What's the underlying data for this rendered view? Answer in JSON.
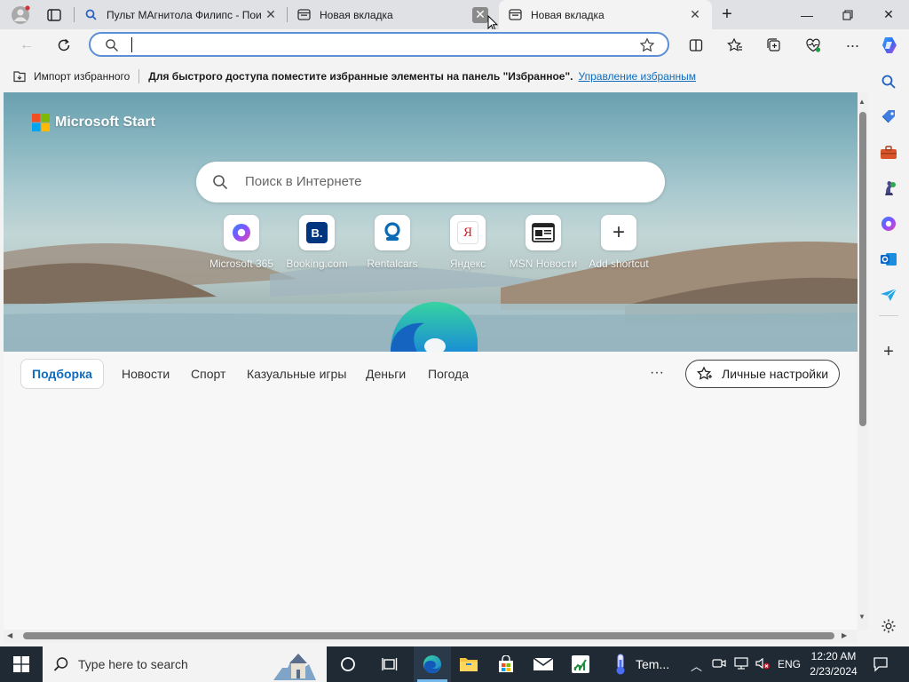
{
  "tabs": [
    {
      "title": "Пульт МАгнитола Филипс - Пои"
    },
    {
      "title": "Новая вкладка"
    },
    {
      "title": "Новая вкладка"
    }
  ],
  "favbar": {
    "import_label": "Импорт избранного",
    "hint": "Для быстрого доступа поместите избранные элементы на панель \"Избранное\".",
    "manage_link": "Управление избранным"
  },
  "page": {
    "brand": "Microsoft Start",
    "search_placeholder": "Поиск в Интернете",
    "quick_links": [
      {
        "label": "Microsoft 365",
        "icon": "microsoft365-icon"
      },
      {
        "label": "Booking.com",
        "icon": "booking-icon"
      },
      {
        "label": "Rentalcars",
        "icon": "rentalcars-icon"
      },
      {
        "label": "Яндекс",
        "icon": "yandex-icon"
      },
      {
        "label": "MSN Новости",
        "icon": "msn-news-icon"
      },
      {
        "label": "Add shortcut",
        "icon": "plus-icon"
      }
    ],
    "categories": [
      "Подборка",
      "Новости",
      "Спорт",
      "Казуальные игры",
      "Деньги",
      "Погода"
    ],
    "more_label": "···",
    "personalize_label": "Личные настройки"
  },
  "taskbar": {
    "search_placeholder": "Type here to search",
    "weather_label": "Tem...",
    "lang": "ENG",
    "time": "12:20 AM",
    "date": "2/23/2024"
  },
  "colors": {
    "accent": "#0f6cbd",
    "taskbar": "#1f2a35",
    "edge_active": "#2b3a4a"
  }
}
